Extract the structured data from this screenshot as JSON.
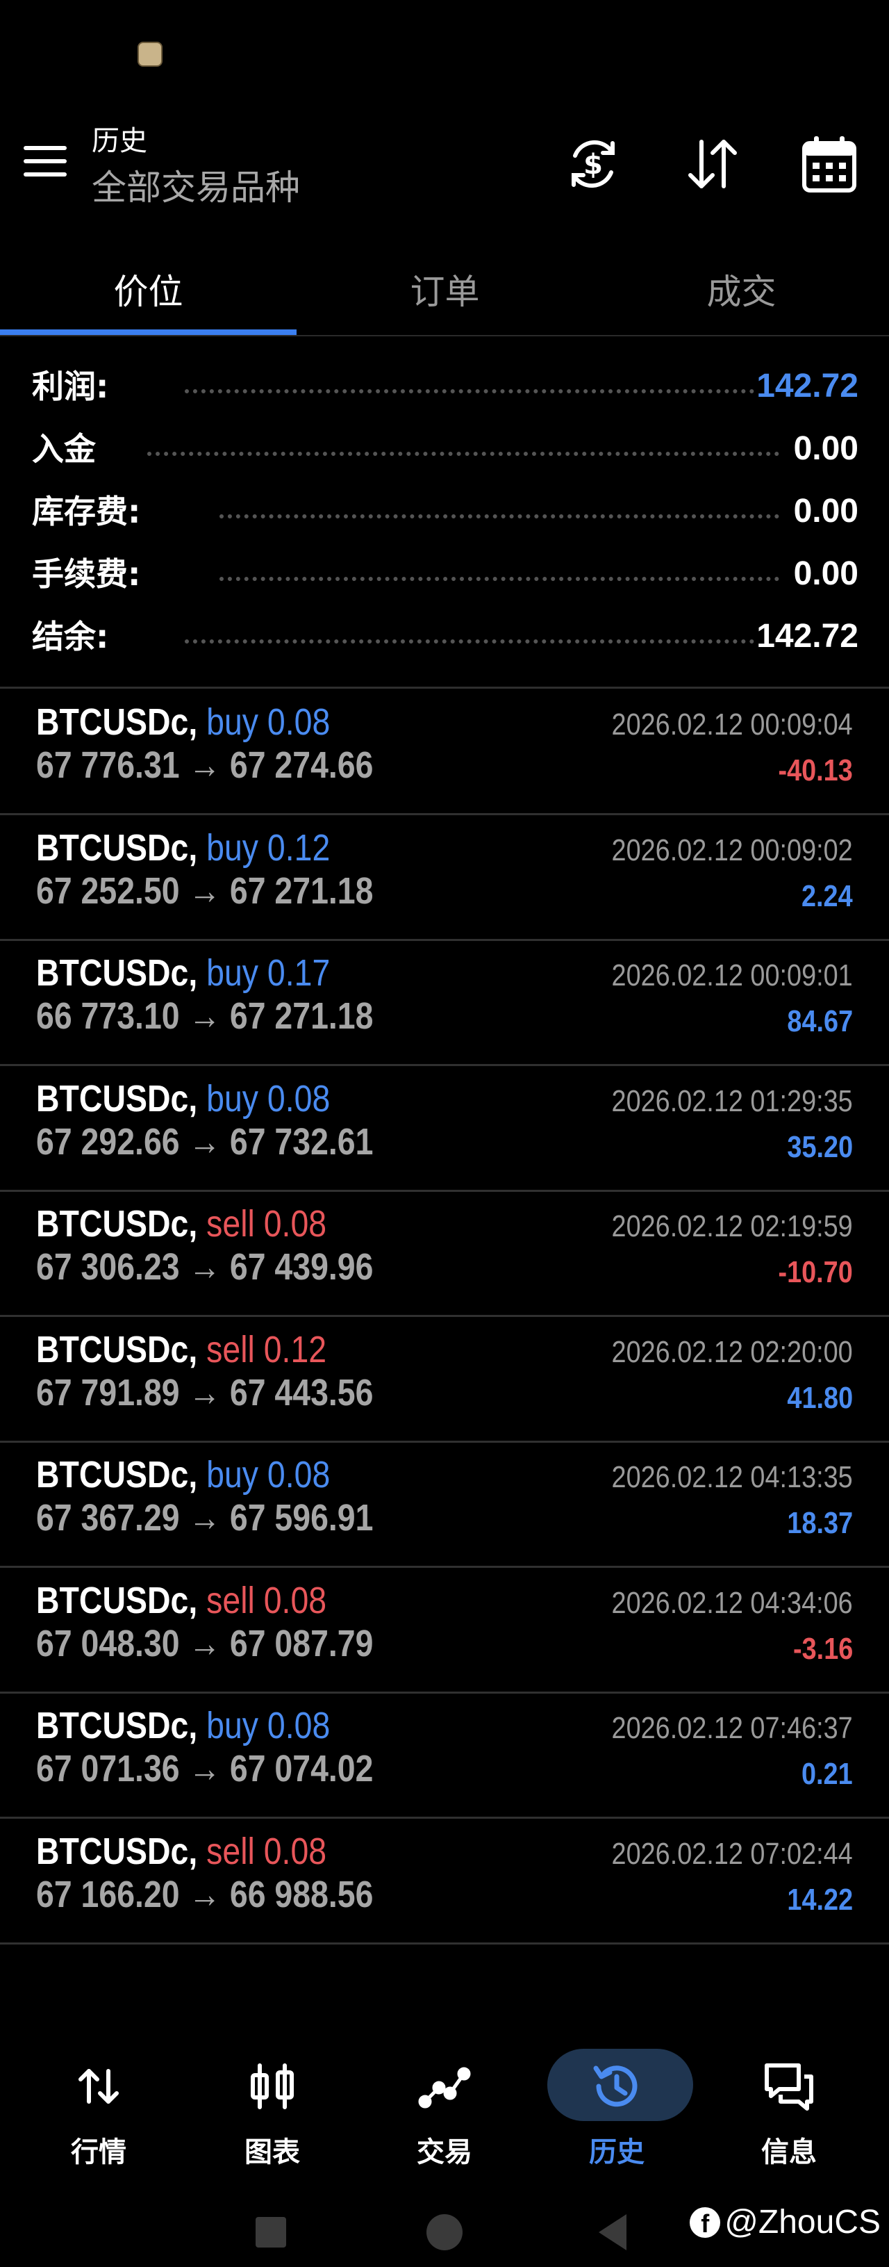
{
  "header": {
    "title": "历史",
    "subtitle": "全部交易品种",
    "icons": [
      "currency-exchange-icon",
      "sort-arrows-icon",
      "calendar-icon"
    ]
  },
  "tabs": [
    {
      "label": "价位",
      "active": true
    },
    {
      "label": "订单",
      "active": false
    },
    {
      "label": "成交",
      "active": false
    }
  ],
  "summary": [
    {
      "label": "利润:",
      "value": "142.72",
      "color": "#4a8bf0"
    },
    {
      "label": "入金",
      "value": "0.00",
      "color": "#ffffff"
    },
    {
      "label": "库存费:",
      "value": "0.00",
      "color": "#ffffff"
    },
    {
      "label": "手续费:",
      "value": "0.00",
      "color": "#ffffff"
    },
    {
      "label": "结余:",
      "value": "142.72",
      "color": "#ffffff"
    }
  ],
  "deals": [
    {
      "symbol": "BTCUSDc,",
      "side": "buy",
      "volume": "buy 0.08",
      "open": "67 776.31",
      "arrow": "→",
      "close": "67 274.66",
      "time": "2026.02.12 00:09:04",
      "profit": "-40.13"
    },
    {
      "symbol": "BTCUSDc,",
      "side": "buy",
      "volume": "buy 0.12",
      "open": "67 252.50",
      "arrow": "→",
      "close": "67 271.18",
      "time": "2026.02.12 00:09:02",
      "profit": "2.24"
    },
    {
      "symbol": "BTCUSDc,",
      "side": "buy",
      "volume": "buy 0.17",
      "open": "66 773.10",
      "arrow": "→",
      "close": "67 271.18",
      "time": "2026.02.12 00:09:01",
      "profit": "84.67"
    },
    {
      "symbol": "BTCUSDc,",
      "side": "buy",
      "volume": "buy 0.08",
      "open": "67 292.66",
      "arrow": "→",
      "close": "67 732.61",
      "time": "2026.02.12 01:29:35",
      "profit": "35.20"
    },
    {
      "symbol": "BTCUSDc,",
      "side": "sell",
      "volume": "sell 0.08",
      "open": "67 306.23",
      "arrow": "→",
      "close": "67 439.96",
      "time": "2026.02.12 02:19:59",
      "profit": "-10.70"
    },
    {
      "symbol": "BTCUSDc,",
      "side": "sell",
      "volume": "sell 0.12",
      "open": "67 791.89",
      "arrow": "→",
      "close": "67 443.56",
      "time": "2026.02.12 02:20:00",
      "profit": "41.80"
    },
    {
      "symbol": "BTCUSDc,",
      "side": "buy",
      "volume": "buy 0.08",
      "open": "67 367.29",
      "arrow": "→",
      "close": "67 596.91",
      "time": "2026.02.12 04:13:35",
      "profit": "18.37"
    },
    {
      "symbol": "BTCUSDc,",
      "side": "sell",
      "volume": "sell 0.08",
      "open": "67 048.30",
      "arrow": "→",
      "close": "67 087.79",
      "time": "2026.02.12 04:34:06",
      "profit": "-3.16"
    },
    {
      "symbol": "BTCUSDc,",
      "side": "buy",
      "volume": "buy 0.08",
      "open": "67 071.36",
      "arrow": "→",
      "close": "67 074.02",
      "time": "2026.02.12 07:46:37",
      "profit": "0.21"
    },
    {
      "symbol": "BTCUSDc,",
      "side": "sell",
      "volume": "sell 0.08",
      "open": "67 166.20",
      "arrow": "→",
      "close": "66 988.56",
      "time": "2026.02.12 07:02:44",
      "profit": "14.22"
    }
  ],
  "bottom_nav": [
    {
      "label": "行情",
      "icon": "quotes-arrows-icon",
      "active": false
    },
    {
      "label": "图表",
      "icon": "candlestick-chart-icon",
      "active": false
    },
    {
      "label": "交易",
      "icon": "trade-line-icon",
      "active": false
    },
    {
      "label": "历史",
      "icon": "history-clock-icon",
      "active": true
    },
    {
      "label": "信息",
      "icon": "messages-icon",
      "active": false
    }
  ],
  "watermark": "@ZhouCS",
  "colors": {
    "accent": "#4a8bf0",
    "loss": "#e8565a",
    "background": "#000000"
  }
}
